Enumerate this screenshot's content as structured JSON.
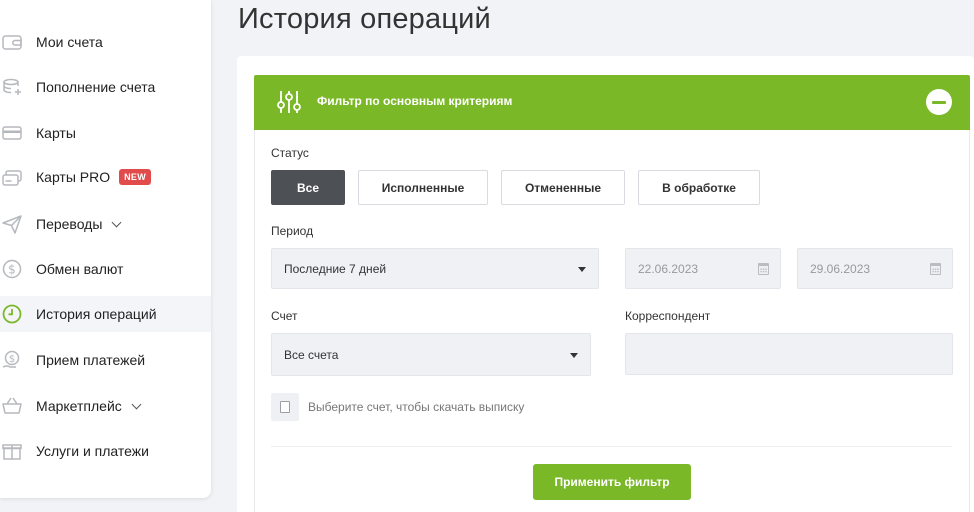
{
  "colors": {
    "accent": "#7ab828",
    "active_button": "#4d5156",
    "badge": "#e14b4b"
  },
  "sidebar": {
    "items": [
      {
        "label": "Мои счета",
        "icon": "wallet-icon"
      },
      {
        "label": "Пополнение счета",
        "icon": "coins-plus-icon"
      },
      {
        "label": "Карты",
        "icon": "card-icon"
      },
      {
        "label": "Карты PRO",
        "icon": "cards-pro-icon",
        "badge": "NEW"
      },
      {
        "label": "Переводы",
        "icon": "send-icon",
        "expandable": true
      },
      {
        "label": "Обмен валют",
        "icon": "currency-exchange-icon"
      },
      {
        "label": "История операций",
        "icon": "clock-history-icon",
        "active": true
      },
      {
        "label": "Прием платежей",
        "icon": "payment-acceptance-icon"
      },
      {
        "label": "Маркетплейс",
        "icon": "basket-icon",
        "expandable": true
      },
      {
        "label": "Услуги и платежи",
        "icon": "gift-services-icon"
      }
    ]
  },
  "page": {
    "title": "История операций"
  },
  "filter": {
    "title": "Фильтр по основным критериям",
    "icon": "sliders-icon",
    "collapse_icon": "minus-circle-icon",
    "status": {
      "label": "Статус",
      "options": [
        "Все",
        "Исполненные",
        "Отмененные",
        "В обработке"
      ],
      "selected": "Все"
    },
    "period": {
      "label": "Период",
      "value": "Последние 7 дней",
      "date_from": "22.06.2023",
      "date_to": "29.06.2023"
    },
    "account": {
      "label": "Счет",
      "value": "Все счета"
    },
    "correspondent": {
      "label": "Корреспондент",
      "value": ""
    },
    "statement_hint": "Выберите счет, чтобы скачать выписку",
    "apply_label": "Применить фильтр"
  }
}
